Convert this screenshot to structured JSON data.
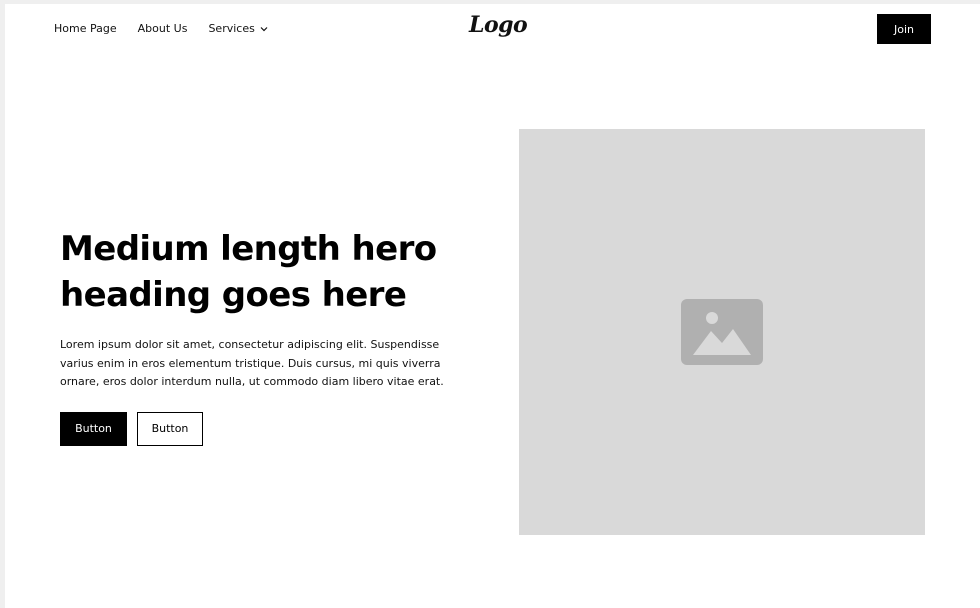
{
  "navbar": {
    "links": [
      {
        "label": "Home Page"
      },
      {
        "label": "About Us"
      },
      {
        "label": "Services"
      }
    ],
    "logo_text": "Logo",
    "join_label": "Join"
  },
  "hero": {
    "heading": "Medium length hero heading goes here",
    "paragraph": "Lorem ipsum dolor sit amet, consectetur adipiscing elit. Suspendisse varius enim in eros elementum tristique. Duis cursus, mi quis viverra ornare, eros dolor interdum nulla, ut commodo diam libero vitae erat.",
    "primary_button": "Button",
    "secondary_button": "Button",
    "image_icon": "image-placeholder-icon"
  },
  "colors": {
    "background": "#ffffff",
    "outer": "#efefef",
    "text": "#000000",
    "placeholder_bg": "#d9d9d9",
    "placeholder_icon": "#b0b0b0"
  }
}
